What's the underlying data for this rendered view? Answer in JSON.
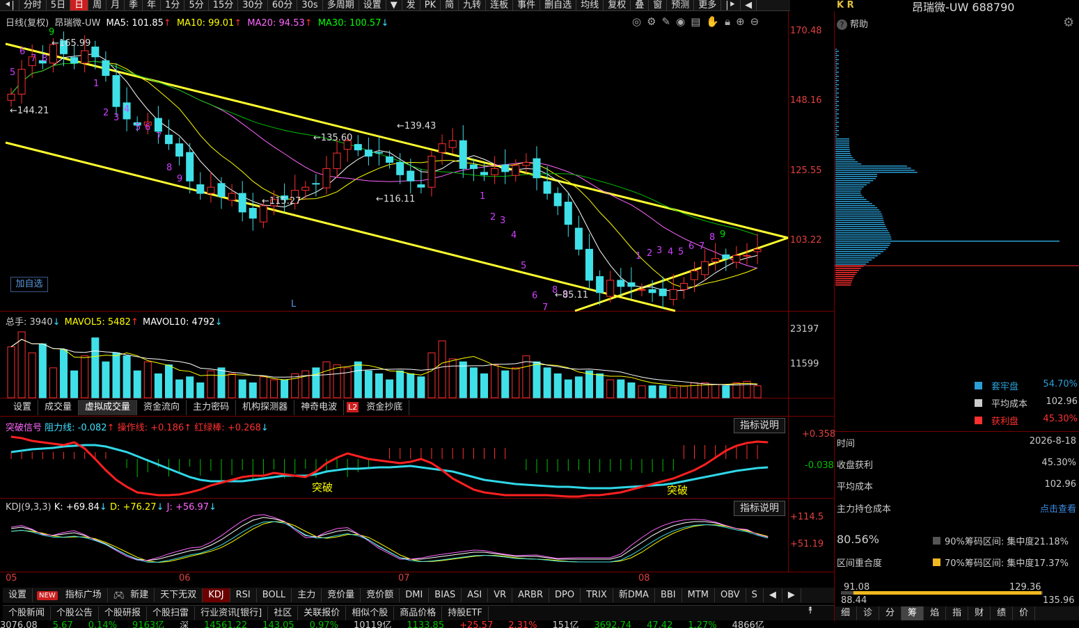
{
  "topbar": {
    "items": [
      "分时",
      "5日",
      "日",
      "周",
      "月",
      "季",
      "年",
      "1分",
      "5分",
      "15分",
      "30分",
      "60分",
      "30s",
      "多周期",
      "设置"
    ],
    "active": "日",
    "right_items": [
      "发",
      "PK",
      "简",
      "九转",
      "连板",
      "事件",
      "删自选",
      "均线",
      "复权",
      "叠",
      "窗",
      "预测",
      "更多"
    ]
  },
  "stock": {
    "name": "昂瑞微-UW 688790",
    "kr": "K R",
    "help": "帮助"
  },
  "main_info": {
    "period": "日线(复权)",
    "name": "昂瑞微-UW",
    "ma5": "MA5: 101.85",
    "ma10": "MA10: 99.01",
    "ma20": "MA20: 94.53",
    "ma30": "MA30: 100.57",
    "ma5_color": "#ffffff",
    "ma10_color": "#ffff00",
    "ma20_color": "#ff66ff",
    "ma30_color": "#00ff00"
  },
  "price_axis": [
    "170.48",
    "148.16",
    "125.55",
    "103.22"
  ],
  "price_marks": [
    "165.99",
    "144.21",
    "135.60",
    "139.43",
    "115.27",
    "116.11",
    "85.11"
  ],
  "add_fav": "加自选",
  "l_mark": "L",
  "td_up": [
    "1",
    "2",
    "3",
    "4",
    "5",
    "6",
    "7",
    "8",
    "9"
  ],
  "td_dn": [
    "1",
    "2",
    "3",
    "4",
    "5",
    "6",
    "7",
    "8",
    "9"
  ],
  "vol_info": {
    "total": "总手: 3940",
    "mavol5": "MAVOL5: 5482",
    "mavol10": "MAVOL10: 4792"
  },
  "vol_axis": [
    "23197",
    "11599"
  ],
  "tabs": [
    "设置",
    "成交量",
    "虚拟成交量",
    "资金流向",
    "主力密码",
    "机构探测器",
    "神奇电波",
    "资金抄底"
  ],
  "tab_selected": "虚拟成交量",
  "l2_badge": "L2",
  "break_info": {
    "title": "突破信号",
    "resist": "阻力线: -0.082",
    "op": "操作线: +0.186",
    "red": "红绿棒: +0.268"
  },
  "break_axis": [
    "+0.358",
    "-0.038"
  ],
  "break_label": "突破",
  "help_btn": "指标说明",
  "kdj_info": {
    "title": "KDJ(9,3,3)",
    "k": "K: +69.84",
    "d": "D: +76.27",
    "j": "J: +56.97"
  },
  "kdj_axis": [
    "+114.5",
    "+51.19"
  ],
  "months": [
    "05",
    "06",
    "07",
    "08"
  ],
  "bottom_tabs": [
    "设置",
    "指标广场",
    "新建",
    "天下无双",
    "KDJ",
    "RSI",
    "BOLL",
    "主力",
    "竞价量",
    "竞价额",
    "DMI",
    "BIAS",
    "ASI",
    "VR",
    "ARBR",
    "DPO",
    "TRIX",
    "新DMA",
    "BBI",
    "MTM",
    "OBV",
    "S"
  ],
  "bottom_tab_selected": "KDJ",
  "new_badge": "NEW",
  "news_tabs": [
    "个股新闻",
    "个股公告",
    "个股研报",
    "个股扫雷",
    "行业资讯[银行]",
    "社区",
    "关联报价",
    "相似个股",
    "商品价格",
    "持股ETF"
  ],
  "chip": {
    "legend": [
      {
        "label": "套牢盘",
        "value": "54.70%",
        "color": "#2a9fd6"
      },
      {
        "label": "平均成本",
        "value": "102.96",
        "color": "#cccccc"
      },
      {
        "label": "获利盘",
        "value": "45.30%",
        "color": "#ff3030"
      }
    ],
    "rows": [
      {
        "k": "时间",
        "v": "2026-8-18"
      },
      {
        "k": "收盘获利",
        "v": "45.30%"
      },
      {
        "k": "平均成本",
        "v": "102.96"
      },
      {
        "k": "主力持仓成本",
        "v": "点击查看"
      }
    ],
    "overlap_pct": "80.56%",
    "overlap_label": "区间重合度",
    "conc90": "90%筹码区间: 集中度21.18%",
    "conc70": "70%筹码区间: 集中度17.37%",
    "range_lo": "91.08",
    "range_hi": "129.36",
    "min": "88.44",
    "max": "135.96",
    "btabs": [
      "细",
      "诊",
      "分",
      "筹",
      "焰",
      "指",
      "财",
      "绩",
      "价"
    ],
    "btab_sel": "筹"
  },
  "status": [
    "3076.08",
    "5.67",
    "0.14%",
    "9163亿",
    "深",
    "14561.22",
    "143.05",
    "0.97%",
    "10119亿",
    "1133.85",
    "+25.57",
    "2.31%",
    "151亿",
    "3692.74",
    "47.42",
    "1.27%",
    "4866亿"
  ]
}
